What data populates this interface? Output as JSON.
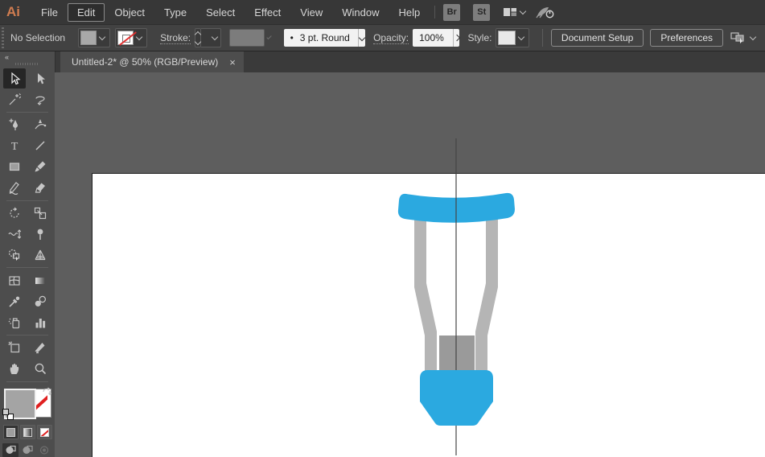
{
  "app": {
    "logo": "Ai"
  },
  "menu_bar": {
    "items": [
      "File",
      "Edit",
      "Object",
      "Type",
      "Select",
      "Effect",
      "View",
      "Window",
      "Help"
    ],
    "active_item": "Edit",
    "bridge_label": "Br",
    "stock_label": "St"
  },
  "control_bar": {
    "selection_status": "No Selection",
    "stroke_label": "Stroke:",
    "brush_preview": "•",
    "brush_value": "3 pt. Round",
    "opacity_label": "Opacity:",
    "opacity_value": "100%",
    "style_label": "Style:",
    "document_setup_label": "Document Setup",
    "preferences_label": "Preferences"
  },
  "document_tab": {
    "title": "Untitled-2* @ 50% (RGB/Preview)",
    "close_glyph": "×"
  },
  "toolbar": {
    "collapse_glyph": "«",
    "tools": [
      "selection-tool",
      "direct-selection-tool",
      "magic-wand-tool",
      "lasso-tool",
      "pen-tool",
      "curvature-tool",
      "type-tool",
      "line-segment-tool",
      "rectangle-tool",
      "paintbrush-tool",
      "shaper-tool",
      "eraser-tool",
      "rotate-tool",
      "scale-tool",
      "width-tool",
      "puppet-warp-tool",
      "shape-builder-tool",
      "perspective-grid-tool",
      "mesh-tool",
      "gradient-tool",
      "eyedropper-tool",
      "blend-tool",
      "symbol-sprayer-tool",
      "column-graph-tool",
      "artboard-tool",
      "slice-tool",
      "hand-tool",
      "zoom-tool"
    ],
    "active_tool": "selection-tool",
    "type_tool_glyph": "T"
  },
  "colors": {
    "artwork_blue": "#2BA9E0",
    "artwork_gray_light": "#B5B5B5",
    "artwork_gray_dark": "#9A9A9A",
    "guide_line": "#454545",
    "logo_orange": "#CF7C50",
    "pasteboard": "#5E5E5E",
    "artboard": "#FFFFFF"
  }
}
